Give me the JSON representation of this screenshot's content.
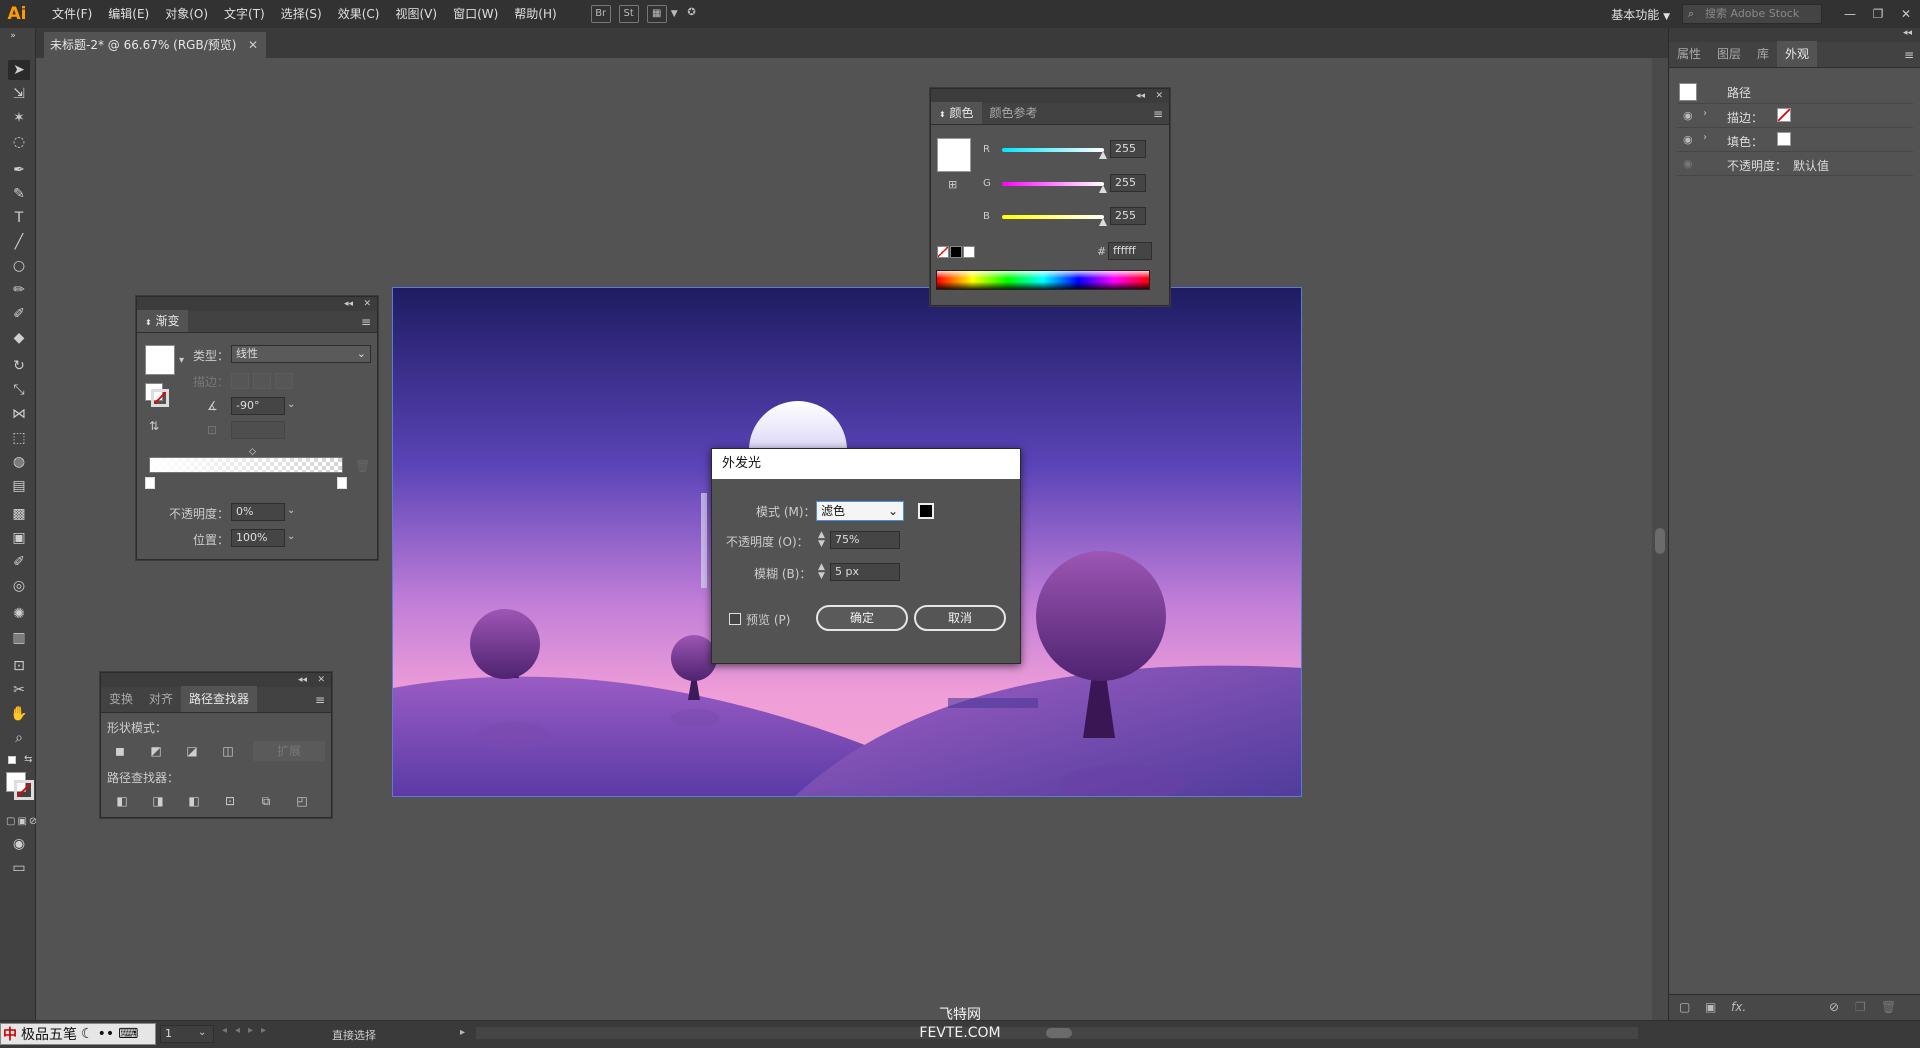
{
  "app": {
    "logo": "Ai",
    "menu": [
      "文件(F)",
      "编辑(E)",
      "对象(O)",
      "文字(T)",
      "选择(S)",
      "效果(C)",
      "视图(V)",
      "窗口(W)",
      "帮助(H)"
    ],
    "toolbar_icons": [
      "Br",
      "St"
    ],
    "workspace": "基本功能",
    "search_placeholder": "搜索 Adobe Stock"
  },
  "document": {
    "tab_title": "未标题-2* @ 66.67% (RGB/预览)"
  },
  "gradient_panel": {
    "tab": "渐变",
    "type_label": "类型：",
    "type_value": "线性",
    "stroke_label": "描边：",
    "angle_value": "-90°",
    "opacity_label": "不透明度：",
    "opacity_value": "0%",
    "position_label": "位置：",
    "position_value": "100%"
  },
  "pathfinder_panel": {
    "tabs": [
      "变换",
      "对齐",
      "路径查找器"
    ],
    "shape_modes_label": "形状模式：",
    "expand_label": "扩展",
    "pathfinders_label": "路径查找器："
  },
  "color_panel": {
    "tabs": [
      "颜色",
      "颜色参考"
    ],
    "channels": [
      {
        "label": "R",
        "value": "255",
        "color": "#00e5ff"
      },
      {
        "label": "G",
        "value": "255",
        "color": "#ff00ff"
      },
      {
        "label": "B",
        "value": "255",
        "color": "#ffff00"
      }
    ],
    "hash_label": "#",
    "hex_value": "ffffff"
  },
  "dialog": {
    "title": "外发光",
    "mode_label": "模式 (M)：",
    "mode_value": "滤色",
    "opacity_label": "不透明度 (O)：",
    "opacity_value": "75%",
    "blur_label": "模糊 (B)：",
    "blur_value": "5 px",
    "preview_label": "预览 (P)",
    "ok_label": "确定",
    "cancel_label": "取消"
  },
  "appearance_panel": {
    "tabs": [
      "属性",
      "图层",
      "库",
      "外观"
    ],
    "path_label": "路径",
    "stroke_label": "描边：",
    "fill_label": "填色：",
    "opacity_label": "不透明度：",
    "opacity_value": "默认值"
  },
  "status_bar": {
    "zoom": "1",
    "tool": "直接选择",
    "ime_label": "极品五笔",
    "ime_lang": "中"
  },
  "watermark": {
    "line1": "飞特网",
    "line2": "FEVTE.COM"
  }
}
